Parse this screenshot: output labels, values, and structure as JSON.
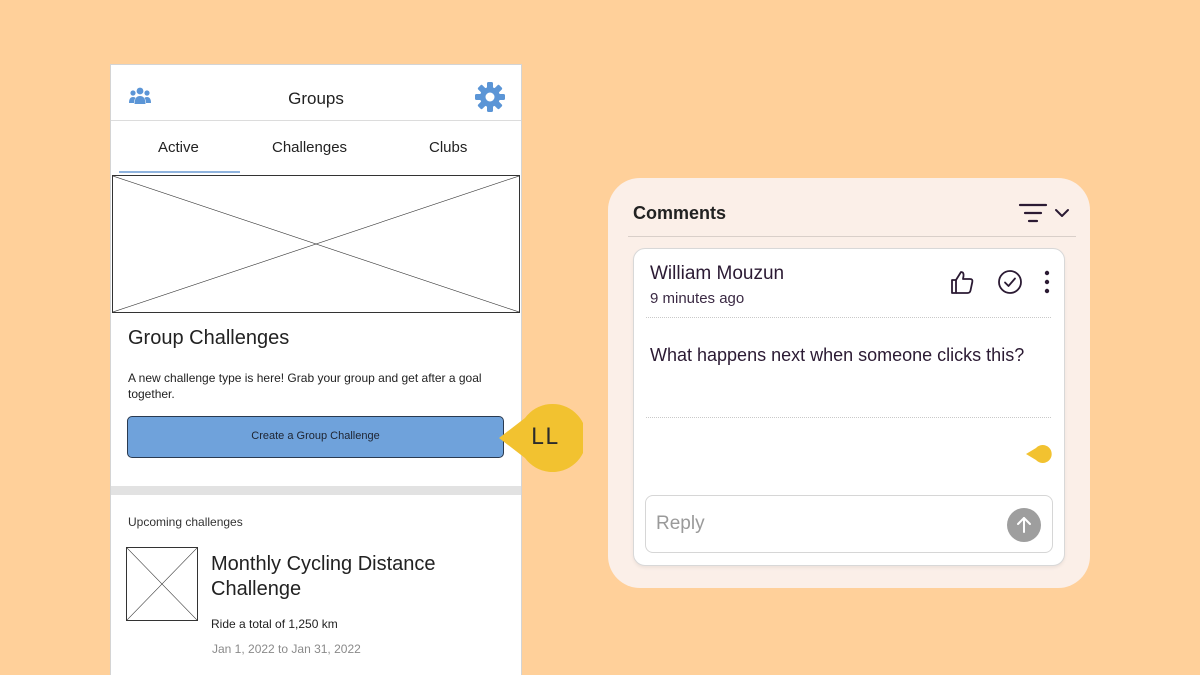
{
  "app": {
    "title": "Groups",
    "tabs": [
      {
        "label": "Active",
        "active": true
      },
      {
        "label": "Challenges",
        "active": false
      },
      {
        "label": "Clubs",
        "active": false
      }
    ]
  },
  "feature": {
    "title": "Group Challenges",
    "description": "A new challenge type is here! Grab your group and get after a goal together.",
    "cta_label": "Create a Group Challenge"
  },
  "upcoming": {
    "label": "Upcoming challenges",
    "items": [
      {
        "title": "Monthly Cycling Distance Challenge",
        "subtitle": "Ride a total of 1,250 km",
        "dates": "Jan 1, 2022 to Jan 31, 2022"
      }
    ]
  },
  "pin": {
    "initials": "LL",
    "color": "#F2C230"
  },
  "comments": {
    "title": "Comments",
    "items": [
      {
        "author": "William Mouzun",
        "time": "9 minutes ago",
        "text": "What happens next when someone clicks this?"
      }
    ],
    "reply_placeholder": "Reply"
  },
  "colors": {
    "background": "#FFD09A",
    "primary_button": "#6FA2DB",
    "icon_blue": "#5B95D6",
    "marker": "#F2C230"
  },
  "icons": [
    "group-icon",
    "gear-icon",
    "filter-icon",
    "chevron-down-icon",
    "thumbs-up-icon",
    "check-circle-icon",
    "more-vertical-icon",
    "arrow-up-icon"
  ]
}
